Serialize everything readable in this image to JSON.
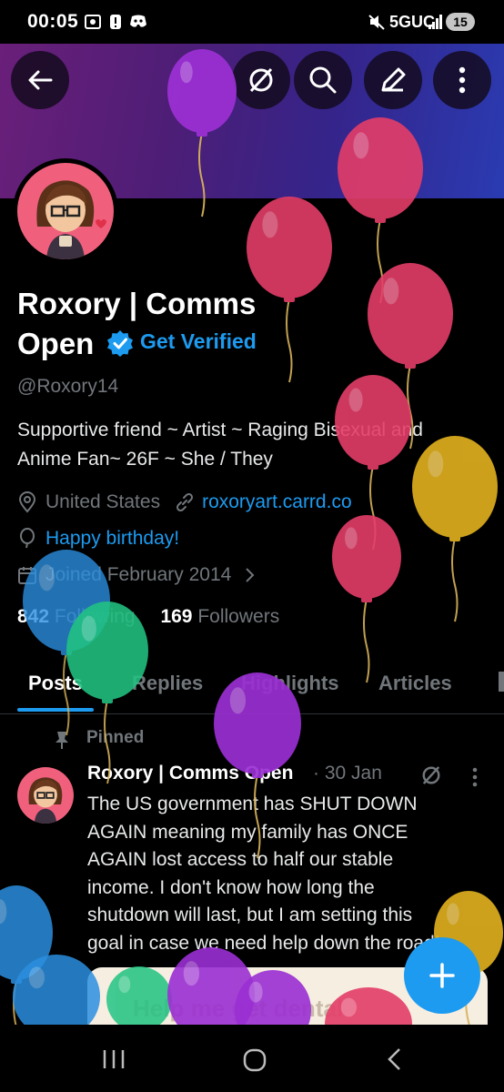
{
  "status": {
    "time": "00:05",
    "network": "5GUC",
    "battery": "15"
  },
  "header": {
    "back_icon": "arrow-left-icon",
    "buttons": [
      "no-sync-icon",
      "search-icon",
      "edit-icon",
      "more-vertical-icon"
    ]
  },
  "profile": {
    "name_line1": "Roxory | Comms",
    "name_line2": "Open",
    "get_verified": "Get Verified",
    "handle": "@Roxory14",
    "bio_line1": "Supportive friend ~ Artist ~  Raging Bisexual and",
    "bio_line2": "Anime Fan~ 26F ~ She / They",
    "location": "United States",
    "website": "roxoryart.carrd.co",
    "birthday": "Happy birthday!",
    "joined": "Joined February 2014",
    "following_count": "842",
    "following_label": "Following",
    "followers_count": "169",
    "followers_label": "Followers"
  },
  "tabs": [
    "Posts",
    "Replies",
    "Highlights",
    "Articles"
  ],
  "post": {
    "pinned_label": "Pinned",
    "author": "Roxory | Comms Open",
    "date": "· 30 Jan",
    "text_lines": [
      "The US government has SHUT DOWN",
      "AGAIN meaning my family has ONCE",
      "AGAIN lost access to half our stable",
      "income. I don't know how long the",
      "shutdown will last, but I am setting this",
      "goal in case we need help down the road!"
    ],
    "card_title": "Help me get dental"
  },
  "colors": {
    "accent": "#1d9bf0",
    "balloon_purple": "#9b2fd3",
    "balloon_red": "#e43d68",
    "balloon_yellow": "#e3b21f",
    "balloon_blue": "#2b8fe0",
    "balloon_green": "#21c382"
  }
}
